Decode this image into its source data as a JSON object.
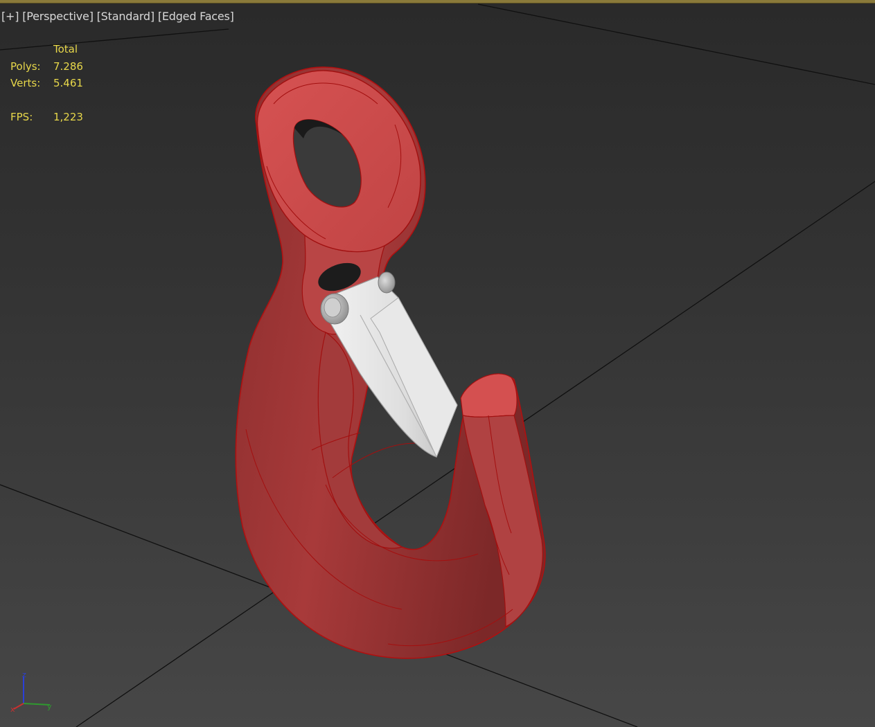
{
  "viewport": {
    "menu": {
      "plus": "[+]",
      "view": "[Perspective]",
      "shading": "[Standard]",
      "display": "[Edged Faces]"
    },
    "stats": {
      "header": "Total",
      "polys_label": "Polys:",
      "polys_value": "7.286",
      "verts_label": "Verts:",
      "verts_value": "5.461",
      "fps_label": "FPS:",
      "fps_value": "1,223"
    },
    "gizmo": {
      "x": "x",
      "y": "y",
      "z": "z"
    }
  },
  "model": {
    "name": "crane-hook",
    "body_color": "#c94a4a",
    "edge_color": "#b01010",
    "latch_color": "#e2e2e2"
  },
  "colors": {
    "stats_text": "#e8d84a",
    "label_text": "#d8d8d8",
    "grid_line": "#0f0f0f",
    "border_accent": "#8a7a3a"
  }
}
